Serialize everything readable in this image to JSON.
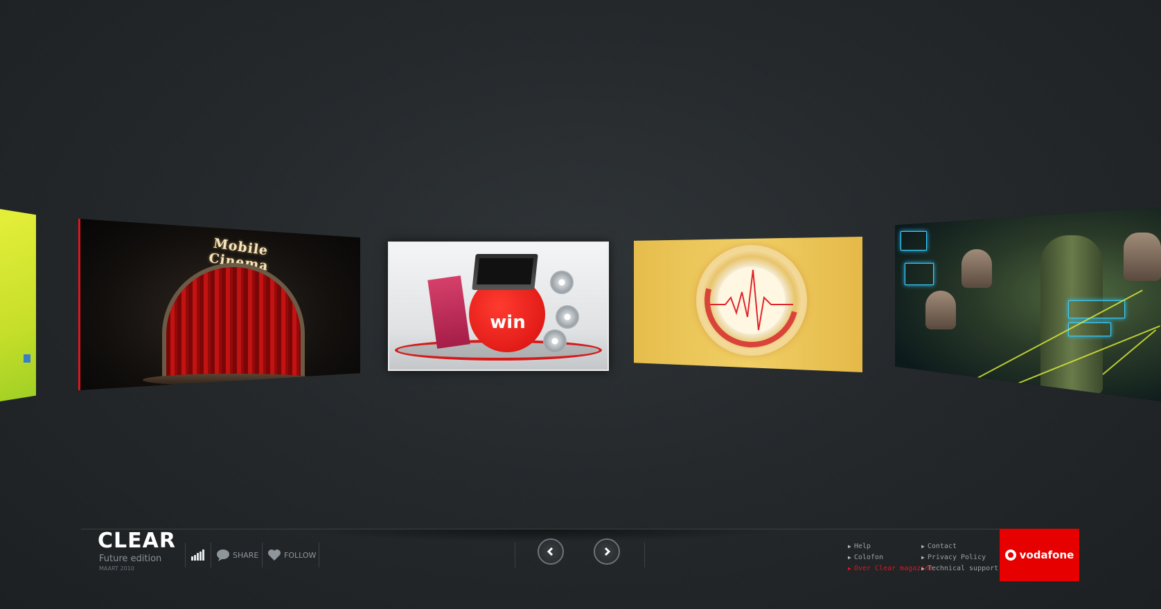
{
  "cards": {
    "cinema_title": "Mobile Cinema",
    "win_label": "win"
  },
  "footer": {
    "logo": "CLEAR",
    "edition": "Future edition",
    "date": "MAART 2010",
    "share_label": "SHARE",
    "follow_label": "FOLLOW",
    "links_col1": [
      "Help",
      "Colofon",
      "Over Clear magazine"
    ],
    "links_col2": [
      "Contact",
      "Privacy Policy",
      "Technical support"
    ],
    "brand": "vodafone"
  },
  "icons": {
    "signal": "signal-bars-icon",
    "share": "speech-bubble-icon",
    "follow": "heart-icon",
    "prev": "chevron-left-icon",
    "next": "chevron-right-icon"
  },
  "colors": {
    "accent": "#e60000",
    "active_link": "#e0141e",
    "background": "#24282b"
  }
}
